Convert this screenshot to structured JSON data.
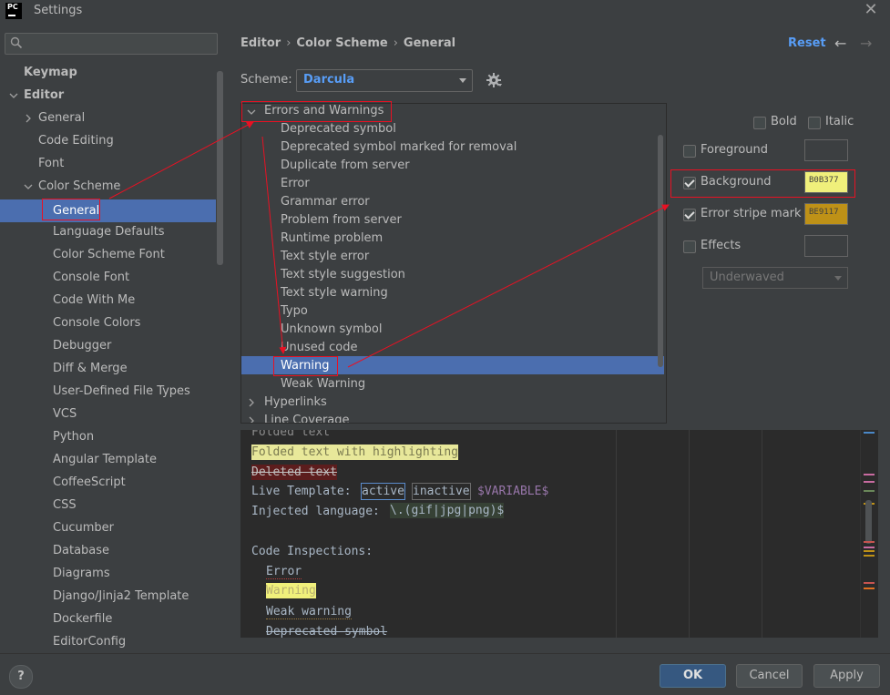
{
  "window": {
    "title": "Settings",
    "logo_text_top": "PC",
    "close_glyph": "✕"
  },
  "search": {
    "placeholder": "",
    "icon": "search-icon"
  },
  "sidebar": {
    "items": [
      {
        "label": "Keymap"
      },
      {
        "label": "Editor"
      },
      {
        "label": "General"
      },
      {
        "label": "Code Editing"
      },
      {
        "label": "Font"
      },
      {
        "label": "Color Scheme"
      },
      {
        "label": "General"
      },
      {
        "label": "Language Defaults"
      },
      {
        "label": "Color Scheme Font"
      },
      {
        "label": "Console Font"
      },
      {
        "label": "Code With Me"
      },
      {
        "label": "Console Colors"
      },
      {
        "label": "Debugger"
      },
      {
        "label": "Diff & Merge"
      },
      {
        "label": "User-Defined File Types"
      },
      {
        "label": "VCS"
      },
      {
        "label": "Python"
      },
      {
        "label": "Angular Template"
      },
      {
        "label": "CoffeeScript"
      },
      {
        "label": "CSS"
      },
      {
        "label": "Cucumber"
      },
      {
        "label": "Database"
      },
      {
        "label": "Diagrams"
      },
      {
        "label": "Django/Jinja2 Template"
      },
      {
        "label": "Dockerfile"
      },
      {
        "label": "EditorConfig"
      }
    ]
  },
  "breadcrumb": {
    "part1": "Editor",
    "part2": "Color Scheme",
    "part3": "General",
    "sep": "›"
  },
  "header": {
    "reset": "Reset",
    "back": "←",
    "forward": "→"
  },
  "scheme": {
    "label": "Scheme:",
    "value": "Darcula"
  },
  "tree": {
    "group_errors": "Errors and Warnings",
    "items": [
      "Deprecated symbol",
      "Deprecated symbol marked for removal",
      "Duplicate from server",
      "Error",
      "Grammar error",
      "Problem from server",
      "Runtime problem",
      "Text style error",
      "Text style suggestion",
      "Text style warning",
      "Typo",
      "Unknown symbol",
      "Unused code",
      "Warning",
      "Weak Warning"
    ],
    "group_hyperlinks": "Hyperlinks",
    "group_line_coverage": "Line Coverage"
  },
  "options": {
    "bold": "Bold",
    "italic": "Italic",
    "foreground": "Foreground",
    "background": "Background",
    "background_hex": "B0B377",
    "error_stripe": "Error stripe mark",
    "error_stripe_hex": "BE9117",
    "effects": "Effects",
    "effect_type": "Underwaved",
    "colors": {
      "background": "#f0f07b",
      "error_stripe": "#be9117",
      "foreground": "#3c3f41"
    }
  },
  "preview": {
    "folded_text": "Folded text",
    "folded_highlight": "Folded text with highlighting",
    "deleted_text": "Deleted text",
    "live_template_label": "Live Template:",
    "active": "active",
    "inactive": "inactive",
    "variable": "$VARIABLE$",
    "injected_label": "Injected language:",
    "injected_value": "\\.(gif|jpg|png)$",
    "inspections_label": "Code Inspections:",
    "error": "Error",
    "warning": "Warning",
    "weak_warning": "Weak warning",
    "deprecated": "Deprecated symbol"
  },
  "buttons": {
    "help": "?",
    "ok": "OK",
    "cancel": "Cancel",
    "apply": "Apply"
  }
}
